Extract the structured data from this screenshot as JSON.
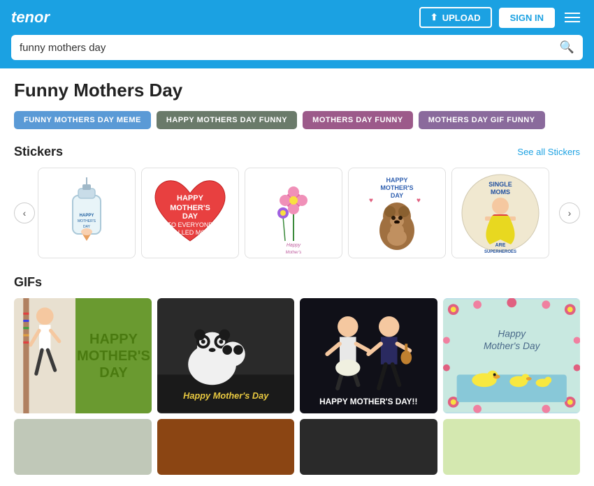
{
  "header": {
    "logo": "tenor",
    "upload_label": "UPLOAD",
    "signin_label": "SIGN IN"
  },
  "search": {
    "placeholder": "funny mothers day",
    "value": "funny mothers day"
  },
  "page": {
    "title": "Funny Mothers Day"
  },
  "tags": [
    {
      "id": "tag-meme",
      "label": "FUNNY MOTHERS DAY MEME",
      "style": "active"
    },
    {
      "id": "tag-happy",
      "label": "HAPPY MOTHERS DAY FUNNY",
      "style": "secondary"
    },
    {
      "id": "tag-funny",
      "label": "MOTHERS DAY FUNNY",
      "style": "tertiary"
    },
    {
      "id": "tag-gif",
      "label": "MOTHERS DAY GIF FUNNY",
      "style": "quaternary"
    }
  ],
  "stickers_section": {
    "title": "Stickers",
    "see_all_label": "See all Stickers"
  },
  "gifs_section": {
    "title": "GIFs"
  },
  "gif1": {
    "text1": "HAPPY",
    "text2": "MOTHER'S",
    "text3": "DAY"
  },
  "gif2": {
    "text": "Happy Mother's Day"
  },
  "gif3": {
    "text": "HAPPY MOTHER'S DAY!!"
  },
  "gif4": {
    "text1": "Happy",
    "text2": "Mother's Day"
  }
}
